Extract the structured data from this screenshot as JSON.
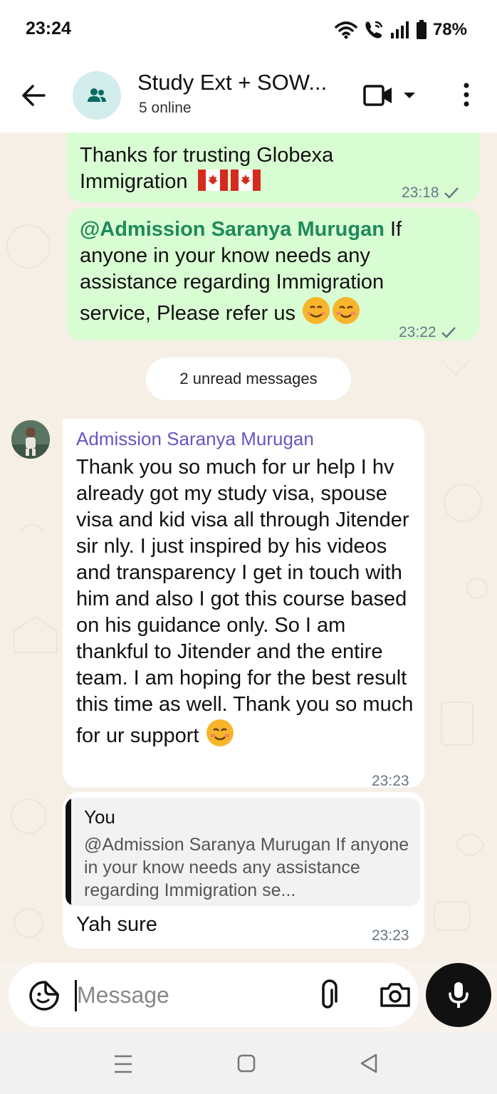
{
  "status_bar": {
    "time": "23:24",
    "battery": "78%",
    "icons": [
      "wifi-icon",
      "wifi-call-icon",
      "signal-icon",
      "battery-icon"
    ]
  },
  "header": {
    "title": "Study Ext + SOW...",
    "subtitle": "5 online",
    "icons": [
      "back-arrow-icon",
      "group-icon",
      "video-call-icon",
      "chevron-down-icon",
      "more-vert-icon"
    ]
  },
  "messages": [
    {
      "direction": "outgoing",
      "text": "Thanks for trusting Globexa Immigration",
      "emoji": [
        "canada-flag",
        "canada-flag"
      ],
      "time": "23:18",
      "status": "sent"
    },
    {
      "direction": "outgoing",
      "mention": "@Admission Saranya Murugan",
      "text": " If anyone in your know needs any assistance regarding Immigration service, Please refer us",
      "emoji": [
        "smiling-face",
        "smiling-face-blush"
      ],
      "time": "23:22",
      "status": "sent"
    },
    {
      "direction": "incoming",
      "sender": "Admission Saranya Murugan",
      "text": "Thank you so much for ur help I hv already got my study visa, spouse visa and kid visa all through Jitender sir nly. I just inspired by his videos and transparency I get in touch with him and also I got this course based on his guidance only. So I am thankful to Jitender and the entire team. I am hoping for the best result this time as well. Thank you so much for ur support",
      "emoji": [
        "smiling-face-blush"
      ],
      "time": "23:23"
    },
    {
      "direction": "incoming",
      "quote": {
        "author": "You",
        "text": "@Admission Saranya Murugan If anyone in your know needs any assistance regarding Immigration se..."
      },
      "text": "Yah sure",
      "time": "23:23"
    }
  ],
  "unread_label": "2 unread messages",
  "input": {
    "placeholder": "Message"
  },
  "colors": {
    "outgoing_bubble": "#d9fdd3",
    "incoming_bubble": "#ffffff",
    "mention": "#1f8a5b",
    "sender_name": "#6a55c2",
    "header_bg": "#ffffff",
    "avatar_bg": "#d3ecec"
  }
}
